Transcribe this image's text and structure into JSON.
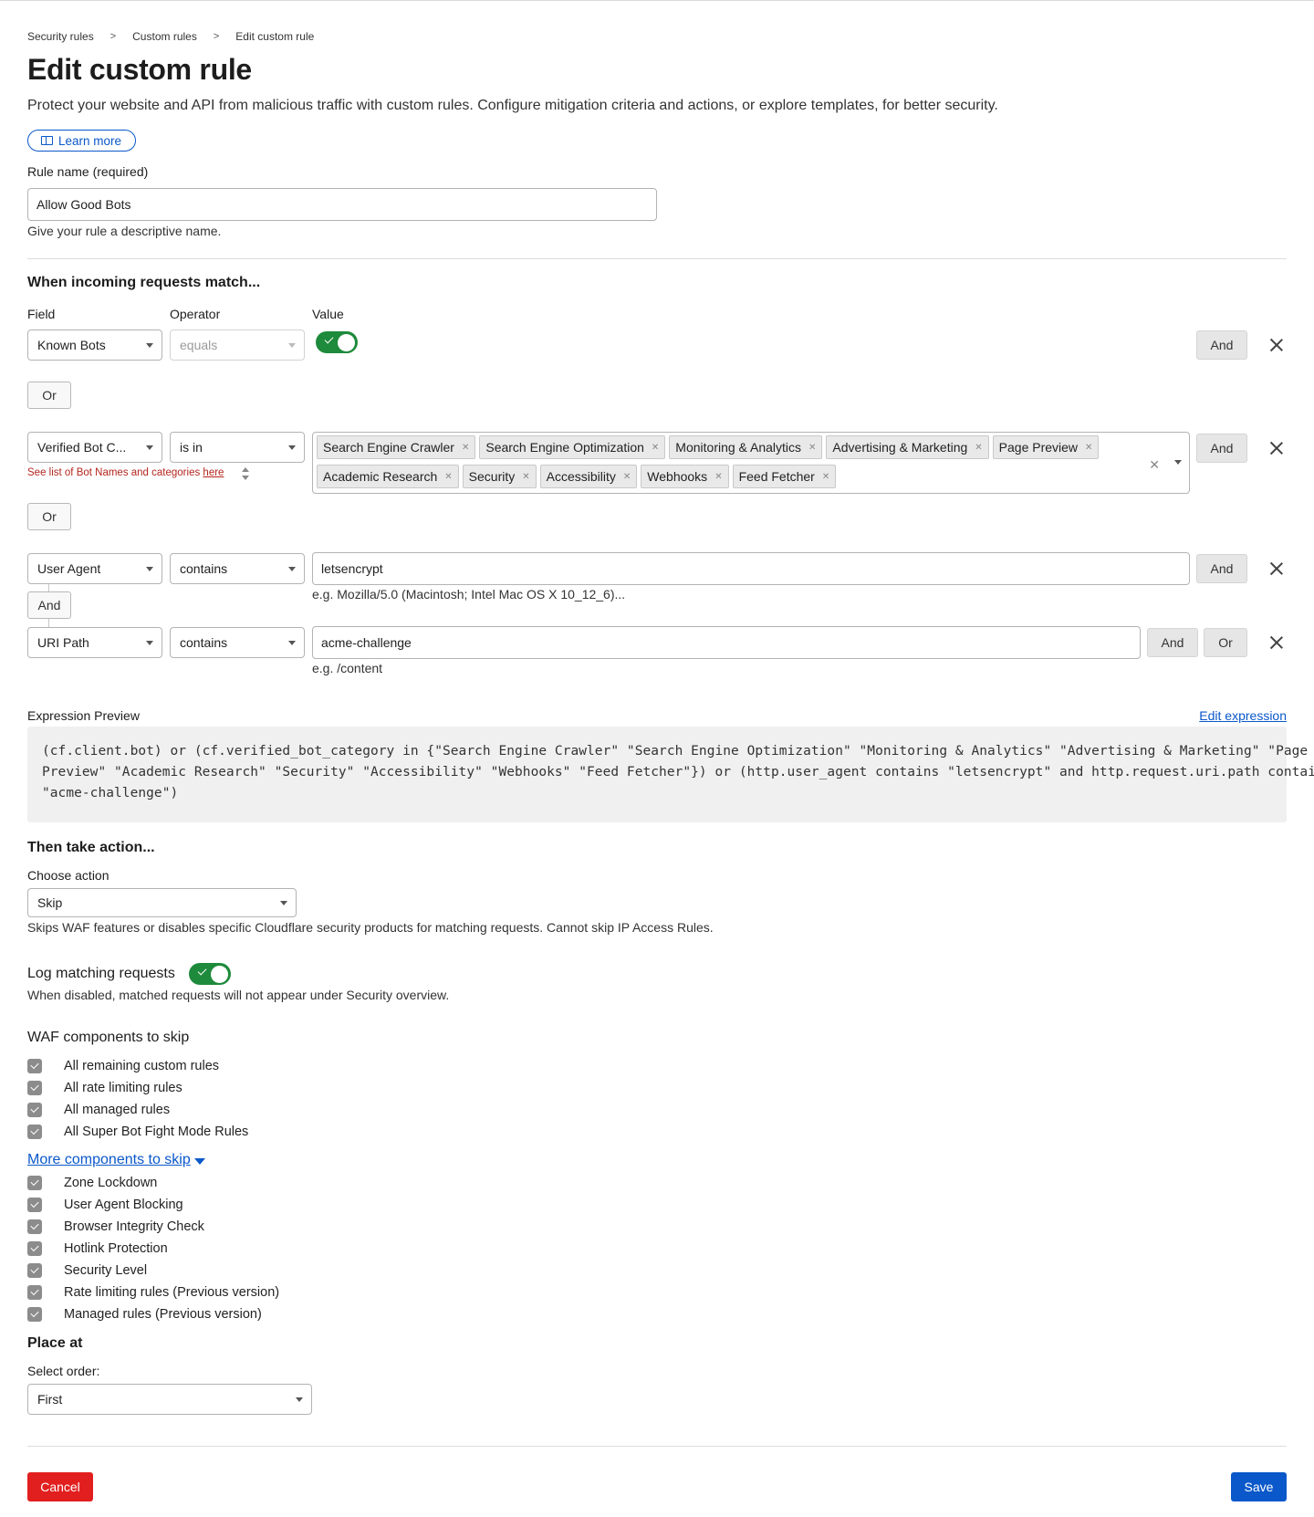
{
  "breadcrumb": {
    "items": [
      "Security rules",
      "Custom rules",
      "Edit custom rule"
    ],
    "separator": ">"
  },
  "page": {
    "title": "Edit custom rule",
    "intro": "Protect your website and API from malicious traffic with custom rules. Configure mitigation criteria and actions, or explore templates, for better security.",
    "learn_more": "Learn more"
  },
  "rule_name": {
    "label": "Rule name (required)",
    "value": "Allow Good Bots",
    "help": "Give your rule a descriptive name."
  },
  "match": {
    "title": "When incoming requests match...",
    "headers": {
      "field": "Field",
      "operator": "Operator",
      "value": "Value"
    },
    "rows": [
      {
        "field": "Known Bots",
        "operator": "equals",
        "value_toggle": true,
        "and": "And"
      },
      {
        "field": "Verified Bot C...",
        "operator": "is in",
        "chips": [
          "Search Engine Crawler",
          "Search Engine Optimization",
          "Monitoring & Analytics",
          "Advertising & Marketing",
          "Page Preview",
          "Academic Research",
          "Security",
          "Accessibility",
          "Webhooks",
          "Feed Fetcher"
        ],
        "note": "See list of Bot Names and categories",
        "note_link": "here",
        "and": "And"
      },
      {
        "field": "User Agent",
        "operator": "contains",
        "value": "letsencrypt",
        "example": "e.g. Mozilla/5.0 (Macintosh; Intel Mac OS X 10_12_6)...",
        "and": "And"
      },
      {
        "field": "URI Path",
        "operator": "contains",
        "value": "acme-challenge",
        "example": "e.g. /content",
        "and": "And",
        "or": "Or"
      }
    ],
    "or_label": "Or",
    "and_label": "And"
  },
  "expression": {
    "label": "Expression Preview",
    "edit_link": "Edit expression",
    "lines": [
      "(cf.client.bot) or (cf.verified_bot_category in {\"Search Engine Crawler\" \"Search Engine Optimization\" \"Monitoring & Analytics\" \"Advertising & Marketing\" \"Page",
      "Preview\" \"Academic Research\" \"Security\" \"Accessibility\" \"Webhooks\" \"Feed Fetcher\"}) or (http.user_agent contains \"letsencrypt\" and http.request.uri.path contains",
      "\"acme-challenge\")"
    ]
  },
  "action": {
    "title": "Then take action...",
    "label": "Choose action",
    "value": "Skip",
    "help": "Skips WAF features or disables specific Cloudflare security products for matching requests. Cannot skip IP Access Rules."
  },
  "log": {
    "label": "Log matching requests",
    "enabled": true,
    "help": "When disabled, matched requests will not appear under Security overview."
  },
  "waf": {
    "title": "WAF components to skip",
    "items": [
      "All remaining custom rules",
      "All rate limiting rules",
      "All managed rules",
      "All Super Bot Fight Mode Rules"
    ],
    "more_link": "More components to skip",
    "more_items": [
      "Zone Lockdown",
      "User Agent Blocking",
      "Browser Integrity Check",
      "Hotlink Protection",
      "Security Level",
      "Rate limiting rules (Previous version)",
      "Managed rules (Previous version)"
    ]
  },
  "place": {
    "title": "Place at",
    "label": "Select order:",
    "value": "First"
  },
  "footer": {
    "cancel": "Cancel",
    "save": "Save"
  },
  "colors": {
    "accent": "#0a58ca",
    "toggle_on": "#1e8a3b",
    "danger": "#e21f1f",
    "chip_bg": "#e9e9e9"
  }
}
